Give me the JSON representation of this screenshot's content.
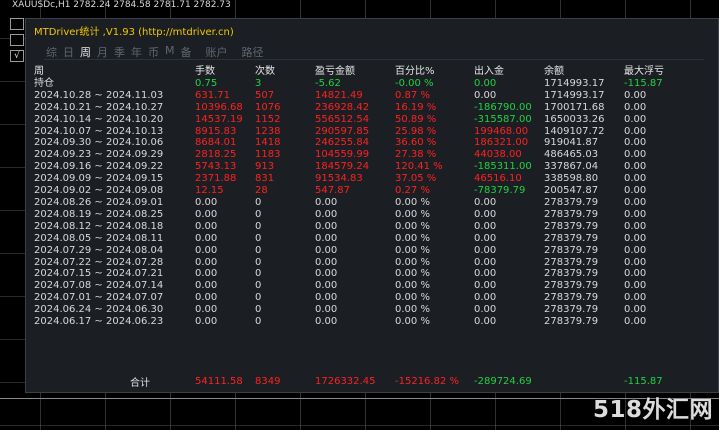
{
  "top_bar": {
    "text": "XAUUSDc,H1  2782.24 2784.58 2781.71 2782.73"
  },
  "left_tools": [
    {
      "label": ""
    },
    {
      "label": ""
    },
    {
      "label": "√"
    }
  ],
  "panel": {
    "title": "MTDriver统计 ,V1.93 (http://mtdriver.cn)",
    "tabs": [
      {
        "label": "综",
        "active": false
      },
      {
        "label": "日",
        "active": false
      },
      {
        "label": "周",
        "active": true
      },
      {
        "label": "月",
        "active": false
      },
      {
        "label": "季",
        "active": false
      },
      {
        "label": "年",
        "active": false
      },
      {
        "label": "币",
        "active": false
      },
      {
        "label": "M",
        "active": false
      },
      {
        "label": "备",
        "active": false
      },
      {
        "label": "账户",
        "active": false
      },
      {
        "label": "路径",
        "active": false
      }
    ],
    "columns": [
      "周",
      "手数",
      "次数",
      "盈亏金额",
      "百分比%",
      "出入金",
      "余额",
      "最大浮亏"
    ],
    "rows": [
      [
        "持仓",
        "0.75",
        "3",
        "-5.62",
        "-0.00 %",
        "0.00",
        "1714993.17",
        "-115.87"
      ],
      [
        "2024.10.28 ~ 2024.11.03",
        "631.71",
        "507",
        "14821.49",
        "0.87 %",
        "0.00",
        "1714993.17",
        "0.00"
      ],
      [
        "2024.10.21 ~ 2024.10.27",
        "10396.68",
        "1076",
        "236928.42",
        "16.19 %",
        "-186790.00",
        "1700171.68",
        "0.00"
      ],
      [
        "2024.10.14 ~ 2024.10.20",
        "14537.19",
        "1152",
        "556512.54",
        "50.89 %",
        "-315587.00",
        "1650033.26",
        "0.00"
      ],
      [
        "2024.10.07 ~ 2024.10.13",
        "8915.83",
        "1238",
        "290597.85",
        "25.98 %",
        "199468.00",
        "1409107.72",
        "0.00"
      ],
      [
        "2024.09.30 ~ 2024.10.06",
        "8684.01",
        "1418",
        "246255.84",
        "36.60 %",
        "186321.00",
        "919041.87",
        "0.00"
      ],
      [
        "2024.09.23 ~ 2024.09.29",
        "2818.25",
        "1183",
        "104559.99",
        "27.38 %",
        "44038.00",
        "486465.03",
        "0.00"
      ],
      [
        "2024.09.16 ~ 2024.09.22",
        "5743.13",
        "913",
        "184579.24",
        "120.41 %",
        "-185311.00",
        "337867.04",
        "0.00"
      ],
      [
        "2024.09.09 ~ 2024.09.15",
        "2371.88",
        "831",
        "91534.83",
        "37.05 %",
        "46516.10",
        "338598.80",
        "0.00"
      ],
      [
        "2024.09.02 ~ 2024.09.08",
        "12.15",
        "28",
        "547.87",
        "0.27 %",
        "-78379.79",
        "200547.87",
        "0.00"
      ],
      [
        "2024.08.26 ~ 2024.09.01",
        "0.00",
        "0",
        "0.00",
        "0.00 %",
        "0.00",
        "278379.79",
        "0.00"
      ],
      [
        "2024.08.19 ~ 2024.08.25",
        "0.00",
        "0",
        "0.00",
        "0.00 %",
        "0.00",
        "278379.79",
        "0.00"
      ],
      [
        "2024.08.12 ~ 2024.08.18",
        "0.00",
        "0",
        "0.00",
        "0.00 %",
        "0.00",
        "278379.79",
        "0.00"
      ],
      [
        "2024.08.05 ~ 2024.08.11",
        "0.00",
        "0",
        "0.00",
        "0.00 %",
        "0.00",
        "278379.79",
        "0.00"
      ],
      [
        "2024.07.29 ~ 2024.08.04",
        "0.00",
        "0",
        "0.00",
        "0.00 %",
        "0.00",
        "278379.79",
        "0.00"
      ],
      [
        "2024.07.22 ~ 2024.07.28",
        "0.00",
        "0",
        "0.00",
        "0.00 %",
        "0.00",
        "278379.79",
        "0.00"
      ],
      [
        "2024.07.15 ~ 2024.07.21",
        "0.00",
        "0",
        "0.00",
        "0.00 %",
        "0.00",
        "278379.79",
        "0.00"
      ],
      [
        "2024.07.08 ~ 2024.07.14",
        "0.00",
        "0",
        "0.00",
        "0.00 %",
        "0.00",
        "278379.79",
        "0.00"
      ],
      [
        "2024.07.01 ~ 2024.07.07",
        "0.00",
        "0",
        "0.00",
        "0.00 %",
        "0.00",
        "278379.79",
        "0.00"
      ],
      [
        "2024.06.24 ~ 2024.06.30",
        "0.00",
        "0",
        "0.00",
        "0.00 %",
        "0.00",
        "278379.79",
        "0.00"
      ],
      [
        "2024.06.17 ~ 2024.06.23",
        "0.00",
        "0",
        "0.00",
        "0.00 %",
        "0.00",
        "278379.79",
        "0.00"
      ]
    ],
    "total": [
      "合计",
      "54111.58",
      "8349",
      "1726332.45",
      "-15216.82 %",
      "-289724.69",
      "",
      "-115.87"
    ]
  },
  "colors": {
    "panel_bg": "#1b1f24",
    "title": "#f0c800",
    "positive": "#ff2020",
    "negative": "#22d040",
    "neutral": "#d8d8d8"
  },
  "watermark": "518外汇网"
}
